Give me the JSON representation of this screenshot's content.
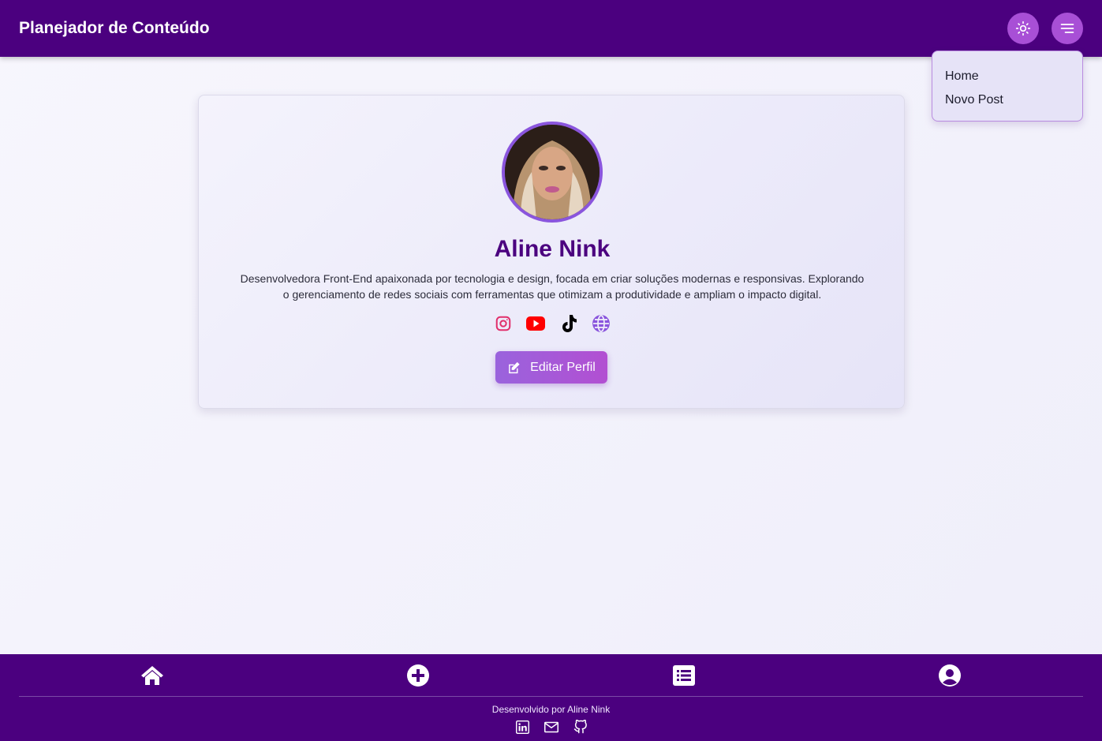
{
  "header": {
    "title": "Planejador de Conteúdo",
    "theme_icon": "sun-icon",
    "menu_icon": "hamburger-menu-icon"
  },
  "dropdown": {
    "items": [
      {
        "label": "Home"
      },
      {
        "label": "Novo Post"
      }
    ]
  },
  "profile": {
    "name": "Aline Nink",
    "bio": "Desenvolvedora Front-End apaixonada por tecnologia e design, focada em criar soluções modernas e responsivas. Explorando o gerenciamento de redes sociais com ferramentas que otimizam a produtividade e ampliam o impacto digital.",
    "socials": [
      {
        "icon": "instagram-icon",
        "color": "#e1306c"
      },
      {
        "icon": "youtube-icon",
        "color": "#ff0000"
      },
      {
        "icon": "tiktok-icon",
        "color": "#000000"
      },
      {
        "icon": "globe-icon",
        "color": "#8a55dd"
      }
    ],
    "edit_label": "Editar Perfil"
  },
  "footer": {
    "nav": [
      {
        "icon": "home-icon"
      },
      {
        "icon": "plus-circle-icon"
      },
      {
        "icon": "list-icon"
      },
      {
        "icon": "user-circle-icon"
      }
    ],
    "credit": "Desenvolvido por Aline Nink",
    "links": [
      {
        "icon": "linkedin-icon"
      },
      {
        "icon": "mail-icon"
      },
      {
        "icon": "github-icon"
      }
    ]
  },
  "colors": {
    "primary": "#4b007f",
    "accent": "#a84fd6",
    "name": "#4b007f"
  }
}
